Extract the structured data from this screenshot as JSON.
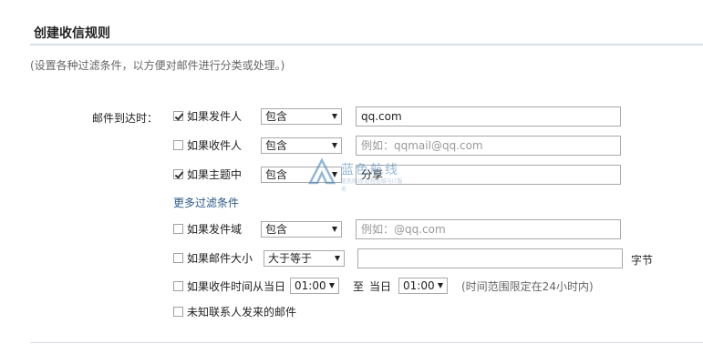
{
  "page": {
    "title": "创建收信规则",
    "description": "(设置各种过滤条件，以方便对邮件进行分类或处理。)"
  },
  "rules": {
    "main_label": "邮件到达时：",
    "sender": {
      "label": "如果发件人",
      "checked": true,
      "operator": "包含",
      "value": "qq.com"
    },
    "recipient": {
      "label": "如果收件人",
      "checked": false,
      "operator": "包含",
      "placeholder": "例如：qqmail@qq.com"
    },
    "subject": {
      "label": "如果主题中",
      "checked": true,
      "operator": "包含",
      "value": "分享"
    },
    "more_filters_label": "更多过滤条件",
    "sender_domain": {
      "label": "如果发件域",
      "checked": false,
      "operator": "包含",
      "placeholder": "例如：@qq.com"
    },
    "mail_size": {
      "label": "如果邮件大小",
      "checked": false,
      "operator": "大于等于",
      "value": "",
      "unit": "字节"
    },
    "receive_time": {
      "label": "如果收件时间从当日",
      "checked": false,
      "start": "01:00",
      "to_label": "至",
      "end_prefix": "当日",
      "end": "01:00",
      "hint": "(时间范围限定在24小时内)"
    },
    "unknown_contact": {
      "label": "未知联系人发来的邮件",
      "checked": false
    }
  },
  "watermark": {
    "text": "蓝色航线",
    "sub": "蓝色航线·远程运维与IT服务"
  }
}
